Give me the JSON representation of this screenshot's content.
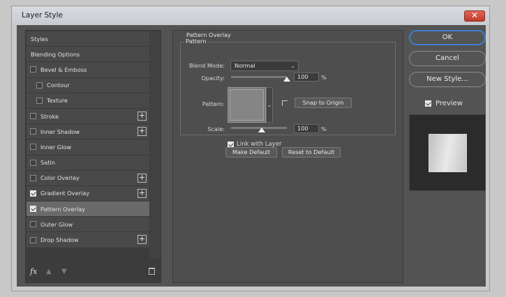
{
  "window": {
    "title": "Layer Style",
    "close_glyph": "✕"
  },
  "styles_list": [
    {
      "label": "Styles",
      "type": "header",
      "selected": false
    },
    {
      "label": "Blending Options",
      "type": "header",
      "selected": false
    },
    {
      "label": "Bevel & Emboss",
      "type": "check",
      "checked": false,
      "plus": false,
      "indent": false
    },
    {
      "label": "Contour",
      "type": "check",
      "checked": false,
      "plus": false,
      "indent": true
    },
    {
      "label": "Texture",
      "type": "check",
      "checked": false,
      "plus": false,
      "indent": true
    },
    {
      "label": "Stroke",
      "type": "check",
      "checked": false,
      "plus": true,
      "indent": false
    },
    {
      "label": "Inner Shadow",
      "type": "check",
      "checked": false,
      "plus": true,
      "indent": false
    },
    {
      "label": "Inner Glow",
      "type": "check",
      "checked": false,
      "plus": false,
      "indent": false
    },
    {
      "label": "Satin",
      "type": "check",
      "checked": false,
      "plus": false,
      "indent": false
    },
    {
      "label": "Color Overlay",
      "type": "check",
      "checked": false,
      "plus": true,
      "indent": false
    },
    {
      "label": "Gradient Overlay",
      "type": "check",
      "checked": true,
      "plus": true,
      "indent": false
    },
    {
      "label": "Pattern Overlay",
      "type": "check",
      "checked": true,
      "plus": false,
      "indent": false,
      "selected": true
    },
    {
      "label": "Outer Glow",
      "type": "check",
      "checked": false,
      "plus": false,
      "indent": false
    },
    {
      "label": "Drop Shadow",
      "type": "check",
      "checked": false,
      "plus": true,
      "indent": false
    }
  ],
  "footer": {
    "fx": "fx",
    "up": "▲",
    "down": "▼"
  },
  "pattern_overlay": {
    "section_title": "Pattern Overlay",
    "group_title": "Pattern",
    "blend_mode_label": "Blend Mode:",
    "blend_mode_value": "Normal",
    "opacity_label": "Opacity:",
    "opacity_value": "100",
    "opacity_percent": 100,
    "pattern_label": "Pattern:",
    "snap_button": "Snap to Origin",
    "scale_label": "Scale:",
    "scale_value": "100",
    "scale_percent": 100,
    "percent_sign": "%",
    "link_label": "Link with Layer",
    "link_checked": true,
    "make_default": "Make Default",
    "reset_default": "Reset to Default"
  },
  "actions": {
    "ok": "OK",
    "cancel": "Cancel",
    "new_style": "New Style..."
  },
  "preview": {
    "label": "Preview",
    "checked": true
  },
  "colors": {
    "accent": "#3f7fd2",
    "panel": "#535353",
    "selected_row": "#6a6a6a"
  },
  "icons": {
    "plus": "+",
    "chevron": "⌄"
  }
}
